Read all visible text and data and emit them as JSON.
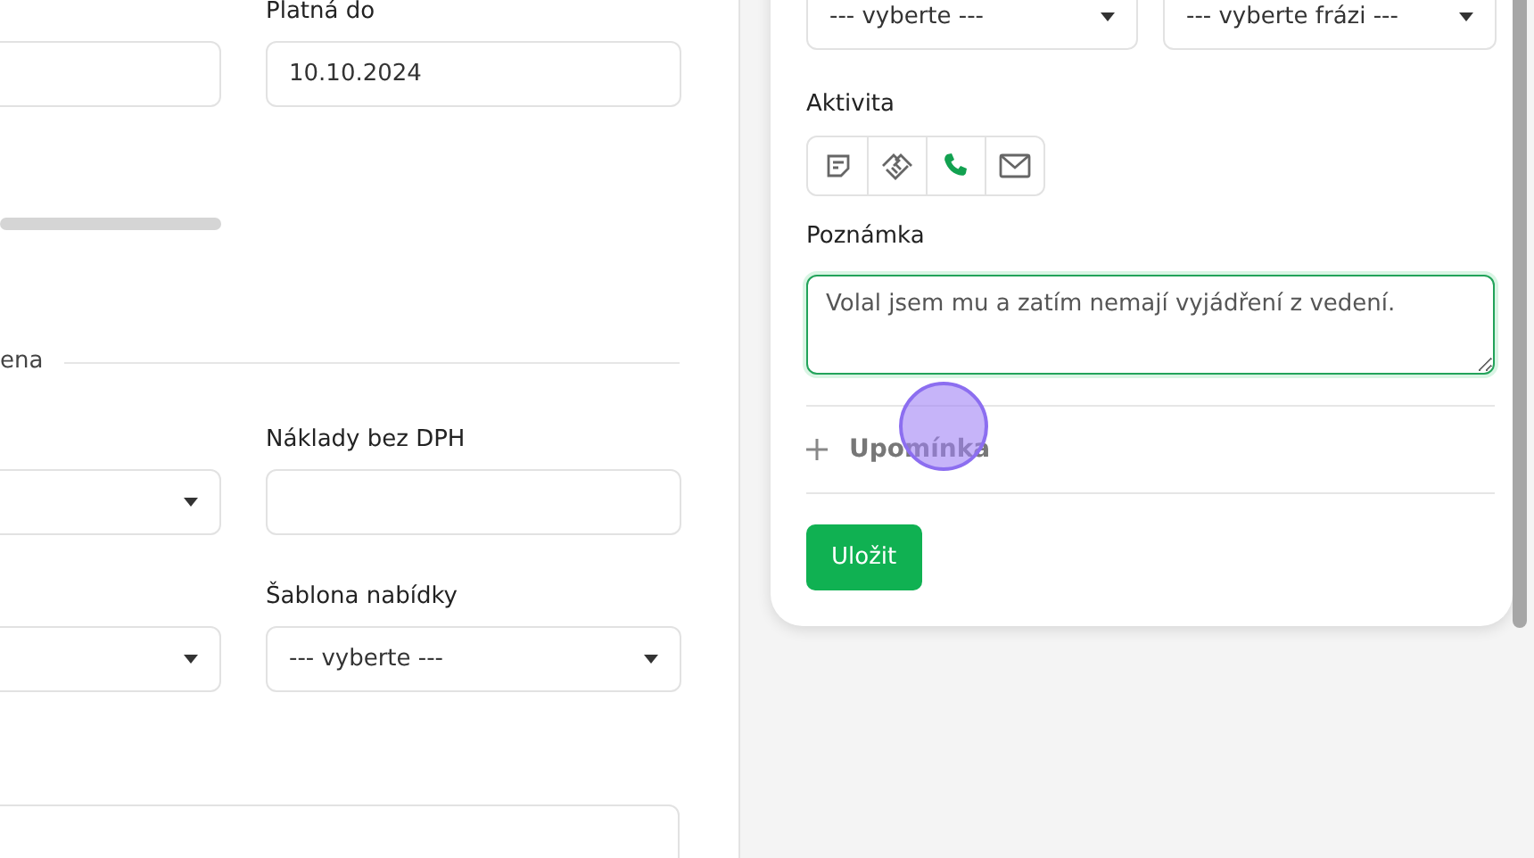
{
  "form": {
    "top_row": {
      "cells": [
        {
          "kind": "input"
        },
        {
          "kind": "input",
          "label": "Platná do",
          "value": "10.10.2024"
        }
      ]
    },
    "section": {
      "title": "ena"
    },
    "rows": [
      {
        "cells": [
          {
            "kind": "select"
          },
          {
            "kind": "input",
            "label": "Náklady bez DPH"
          }
        ]
      },
      {
        "cells": [
          {
            "kind": "select"
          },
          {
            "kind": "select",
            "label": "Šablona nabídky",
            "value": "--- vyberte ---"
          }
        ]
      }
    ],
    "bottom_field": {
      "kind": "input"
    }
  },
  "activity_panel": {
    "selects": [
      {
        "value": "--- vyberte ---"
      },
      {
        "value": "--- vyberte frázi ---"
      }
    ],
    "activity_label": "Aktivita",
    "activity_types": [
      {
        "kind": "note",
        "selected": false
      },
      {
        "kind": "handshake",
        "selected": false
      },
      {
        "kind": "phone",
        "selected": true
      },
      {
        "kind": "mail",
        "selected": false
      }
    ],
    "note_label": "Poznámka",
    "note": {
      "value": "Volal jsem mu a zatím nemají vyjádření z vedení."
    },
    "reminder": {
      "label": "Upomínka"
    },
    "save_button": "Uložit"
  }
}
